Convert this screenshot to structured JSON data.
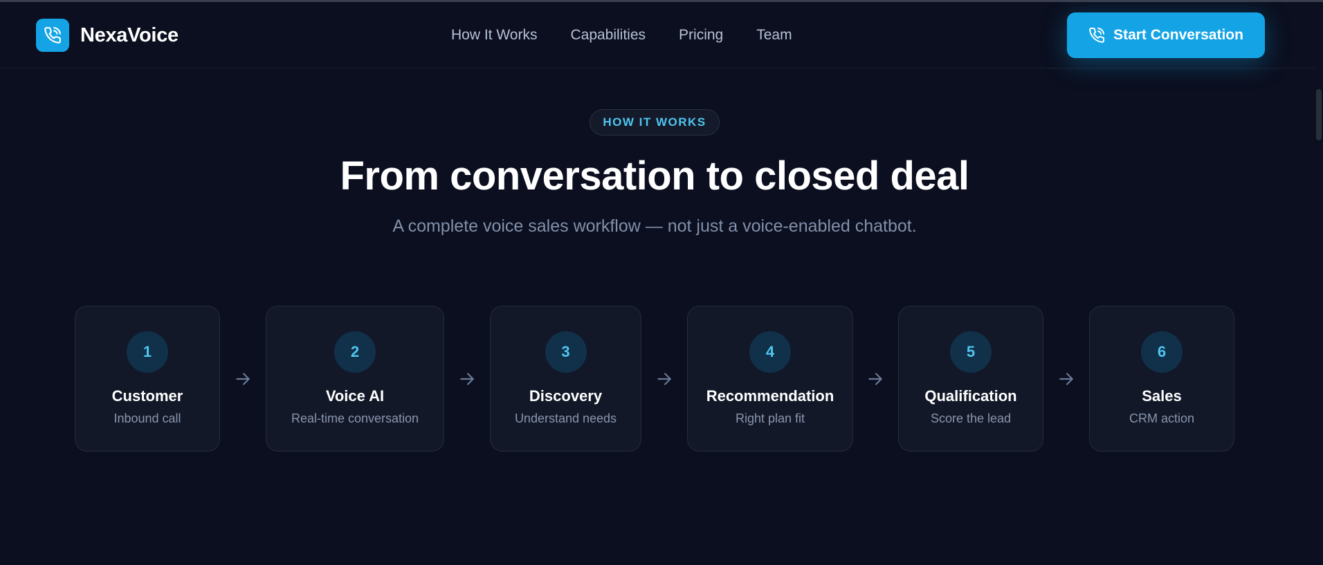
{
  "header": {
    "brand_name": "NexaVoice",
    "logo_icon": "phone-icon",
    "nav": [
      {
        "label": "How It Works"
      },
      {
        "label": "Capabilities"
      },
      {
        "label": "Pricing"
      },
      {
        "label": "Team"
      }
    ],
    "cta_label": "Start Conversation",
    "cta_icon": "phone-icon"
  },
  "hero": {
    "badge": "HOW IT WORKS",
    "title": "From conversation to closed deal",
    "subtitle": "A complete voice sales workflow — not just a voice-enabled chatbot."
  },
  "steps": [
    {
      "number": "1",
      "title": "Customer",
      "description": "Inbound call"
    },
    {
      "number": "2",
      "title": "Voice AI",
      "description": "Real-time conversation"
    },
    {
      "number": "3",
      "title": "Discovery",
      "description": "Understand needs"
    },
    {
      "number": "4",
      "title": "Recommendation",
      "description": "Right plan fit"
    },
    {
      "number": "5",
      "title": "Qualification",
      "description": "Score the lead"
    },
    {
      "number": "6",
      "title": "Sales",
      "description": "CRM action"
    }
  ],
  "colors": {
    "background": "#0b0f1f",
    "accent": "#14a4e6",
    "accent_text": "#4fc6f0",
    "card": "#121828",
    "muted_text": "#8a96ae"
  }
}
